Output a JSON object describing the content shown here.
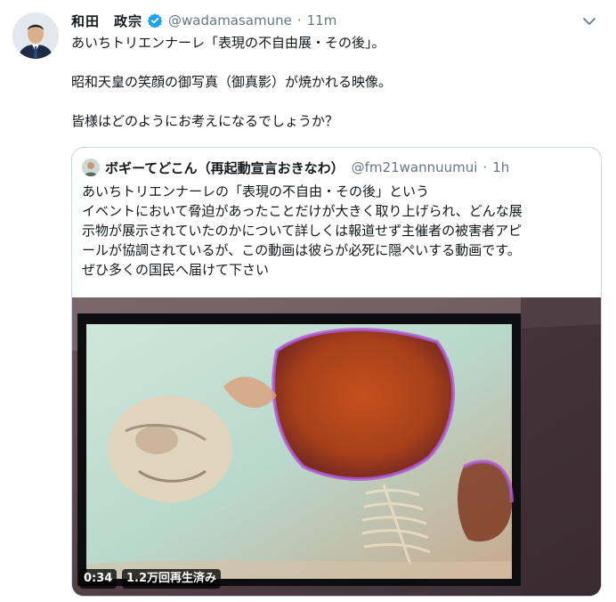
{
  "tweet": {
    "display_name": "和田　政宗",
    "handle": "@wadamasamune",
    "separator": "·",
    "time": "11m",
    "lines": [
      "あいちトリエンナーレ「表現の不自由展・その後」。",
      "昭和天皇の笑顔の御写真（御真影）が焼かれる映像。",
      "皆様はどのようにお考えになるでしょうか？"
    ]
  },
  "quoted": {
    "display_name": "ボギーてどこん（再起動宣言おきなわ）",
    "handle": "@fm21wannuumui",
    "separator": "·",
    "time": "1h",
    "lines": [
      "あいちトリエンナーレの「表現の不自由・その後」という",
      "イベントにおいて脅迫があったことだけが大きく取り上げられ、どんな展",
      "示物が展示されていたのかについて詳しくは報道せず主催者の被害者アピ",
      "ールが協調されているが、この動画は彼らが必死に隠ぺいする動画です。",
      "ぜひ多くの国民へ届けて下さい"
    ],
    "video": {
      "duration": "0:34",
      "views": "1.2万回再生済み"
    }
  },
  "icons": {
    "verified": "verified-badge-icon",
    "caret": "chevron-down-icon"
  },
  "colors": {
    "verified_blue": "#1da1f2",
    "secondary_text": "#657786",
    "border": "#ccd6dd"
  }
}
